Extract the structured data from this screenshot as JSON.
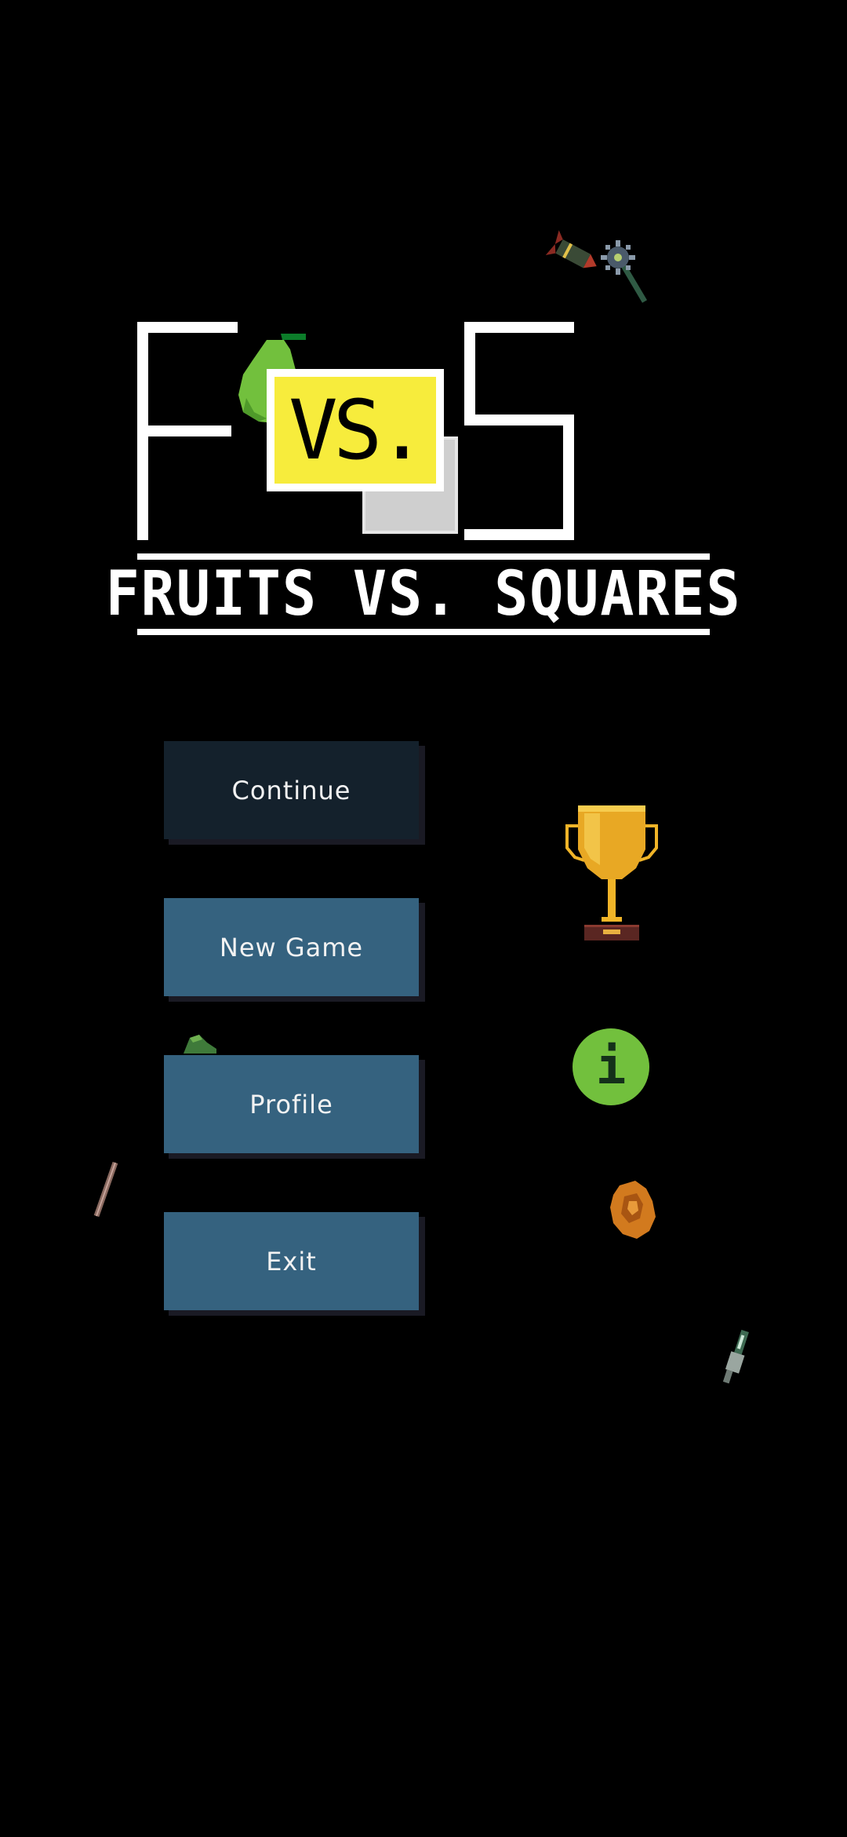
{
  "logo": {
    "vs_text": "VS.",
    "subtitle": "FRUITS VS. SQUARES"
  },
  "menu": {
    "continue_label": "Continue",
    "new_game_label": "New Game",
    "profile_label": "Profile",
    "exit_label": "Exit"
  },
  "icons": {
    "trophy": "trophy-icon",
    "info": "info-icon",
    "info_glyph": "i"
  },
  "colors": {
    "background": "#000000",
    "button": "#35627f",
    "button_disabled": "#14212c",
    "vs_yellow": "#f7ec3c",
    "pear_green": "#72c03d",
    "trophy_gold": "#f0b428"
  }
}
